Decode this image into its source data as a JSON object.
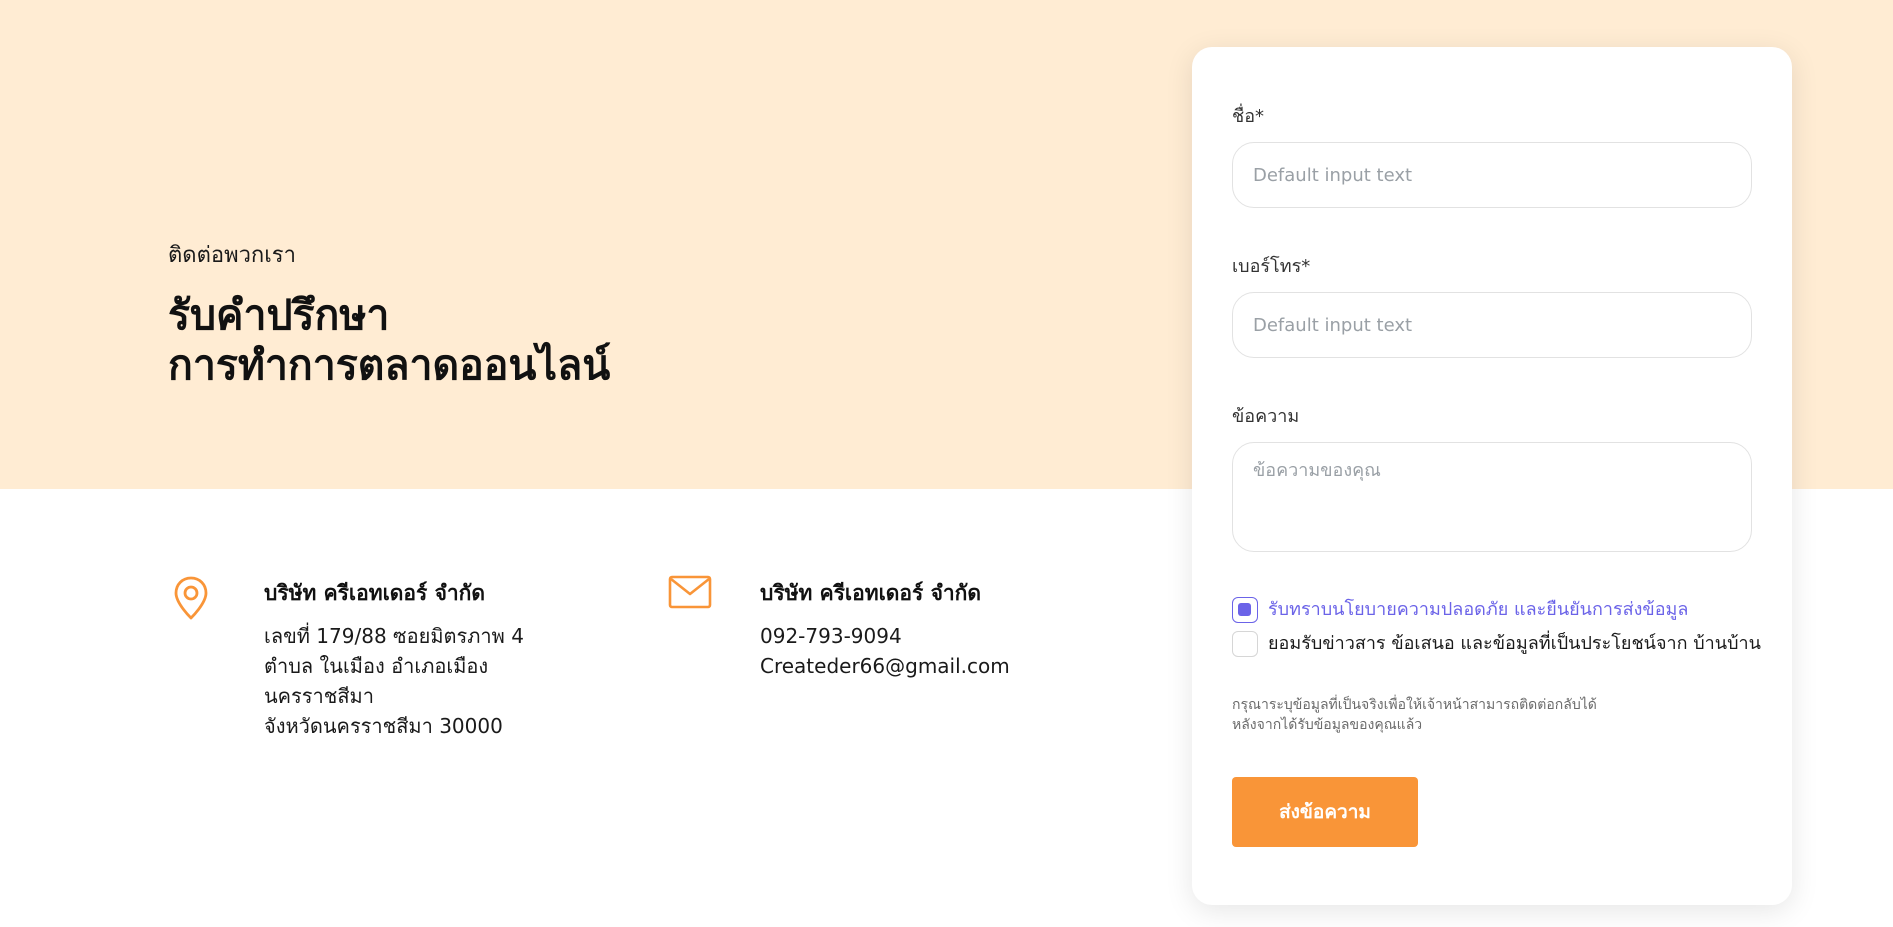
{
  "hero": {
    "eyebrow": "ติดต่อพวกเรา",
    "headline_line1": "รับคำปรึกษา",
    "headline_line2": "การทำการตลาดออนไลน์"
  },
  "address": {
    "icon": "location-pin-icon",
    "title": "บริษัท ครีเอทเดอร์ จำกัด",
    "lines": [
      "เลขที่ 179/88 ซอยมิตรภาพ 4",
      "ตำบล ในเมือง อำเภอเมือง",
      "นครราชสีมา",
      "จังหวัดนครราชสีมา 30000"
    ]
  },
  "contact": {
    "icon": "mail-icon",
    "title": "บริษัท ครีเอทเดอร์ จำกัด",
    "phone": "092-793-9094",
    "email": "Createder66@gmail.com"
  },
  "form": {
    "name_label": "ชื่อ*",
    "name_placeholder": "Default input text",
    "phone_label": "เบอร์โทร*",
    "phone_placeholder": "Default input text",
    "message_label": "ข้อความ",
    "message_placeholder": "ข้อความของคุณ",
    "consent_privacy": "รับทราบนโยบายความปลอดภัย และยืนยันการส่งข้อมูล",
    "consent_privacy_checked": true,
    "consent_news": "ยอมรับข่าวสาร ข้อเสนอ และข้อมูลที่เป็นประโยชน์จาก บ้านบ้าน",
    "consent_news_checked": false,
    "note_line1": "กรุณาระบุข้อมูลที่เป็นจริงเพื่อให้เจ้าหน้าสามารถติดต่อกลับได้",
    "note_line2": "หลังจากได้รับข้อมูลของคุณแล้ว",
    "submit_label": "ส่งข้อความ"
  },
  "colors": {
    "hero_background": "#ffecd3",
    "accent_orange": "#f99538",
    "accent_purple": "#6b63e8"
  }
}
